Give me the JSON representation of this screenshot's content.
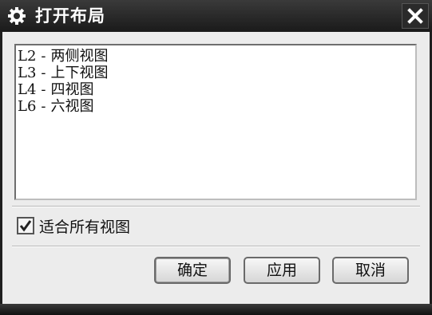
{
  "window": {
    "title": "打开布局",
    "icon": "gear-icon",
    "close_icon": "close-icon"
  },
  "layouts": [
    {
      "code": "L2",
      "sep": "-",
      "name": "两侧视图"
    },
    {
      "code": "L3",
      "sep": "-",
      "name": "上下视图"
    },
    {
      "code": "L4",
      "sep": "-",
      "name": "四视图"
    },
    {
      "code": "L6",
      "sep": "-",
      "name": "六视图"
    }
  ],
  "fit_all_views": {
    "label": "适合所有视图",
    "checked": true
  },
  "buttons": {
    "ok": "确定",
    "apply": "应用",
    "cancel": "取消"
  }
}
